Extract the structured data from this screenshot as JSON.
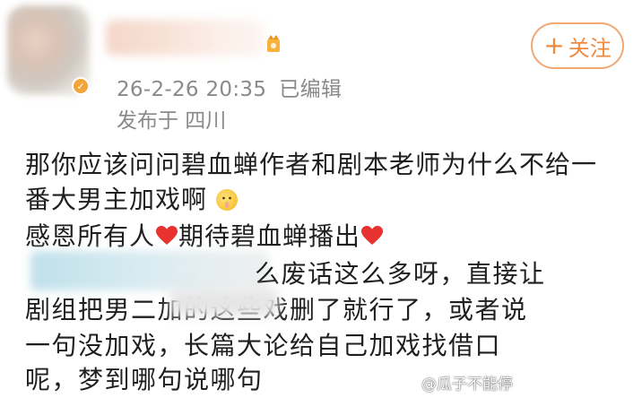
{
  "post": {
    "timestamp": "26-2-26 20:35",
    "edited_label": "已编辑",
    "location": "发布于 四川",
    "follow_label": "关注",
    "follow_plus": "+",
    "lines": [
      "那你应该问问碧血蝉作者和剧本老师为什么不给一",
      "番大男主加戏啊",
      "感恩所有人",
      "期待碧血蝉播出"
    ]
  },
  "reply": {
    "lines": [
      "么废话这么多呀，直接让",
      "剧组把男二加的这些戏删了就行了，或者说",
      "一句没加戏，长篇大论给自己加戏找借口",
      "呢，梦到哪句说哪句"
    ]
  },
  "watermark": "@瓜子不能停",
  "colors": {
    "accent": "#f08a3c",
    "meta_gray": "#8a8a8a",
    "heart_red": "#e8322f"
  },
  "icons": {
    "vip": "vip-crown-icon",
    "heart": "heart-icon",
    "emoji": "shush-face-icon",
    "badge": "verified-badge-icon"
  }
}
